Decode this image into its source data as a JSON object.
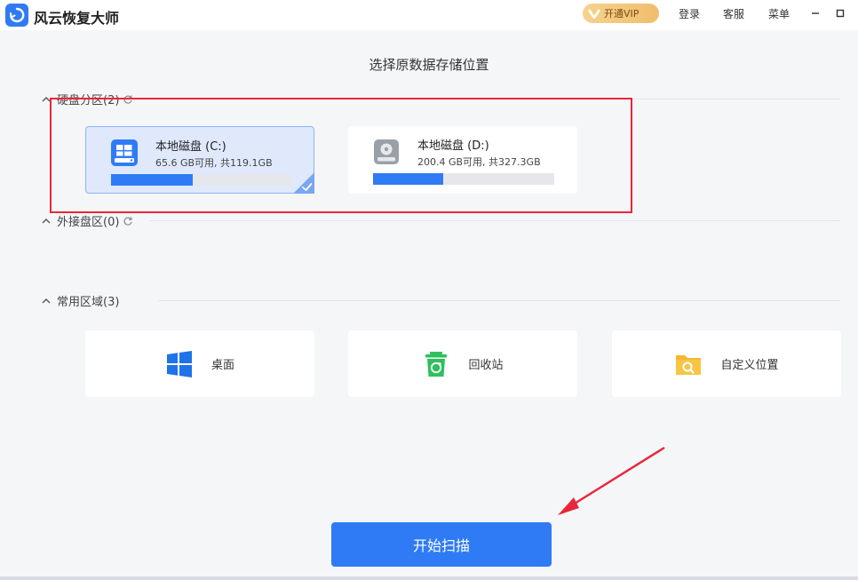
{
  "app": {
    "title": "风云恢复大师",
    "vip_label": "开通VIP",
    "links": [
      "登录",
      "客服",
      "菜单"
    ]
  },
  "main": {
    "heading": "选择原数据存储位置"
  },
  "sections": {
    "hard_disk": {
      "label": "硬盘分区(2)"
    },
    "external": {
      "label": "外接盘区(0)"
    },
    "common": {
      "label": "常用区域(3)"
    }
  },
  "drives": [
    {
      "name": "本地磁盘 (C:)",
      "space": "65.6 GB可用, 共119.1GB",
      "used_percent": 44.9,
      "selected": true
    },
    {
      "name": "本地磁盘 (D:)",
      "space": "200.4 GB可用, 共327.3GB",
      "used_percent": 38.8,
      "selected": false
    }
  ],
  "locations": [
    {
      "label": "桌面",
      "icon": "windows-icon"
    },
    {
      "label": "回收站",
      "icon": "recycle-bin-icon"
    },
    {
      "label": "自定义位置",
      "icon": "folder-search-icon"
    }
  ],
  "actions": {
    "start_scan": "开始扫描"
  },
  "colors": {
    "accent": "#2f7bf5",
    "annotation": "#e8283a",
    "recycle_green": "#2fbf5c",
    "folder_yellow": "#f5b731"
  }
}
